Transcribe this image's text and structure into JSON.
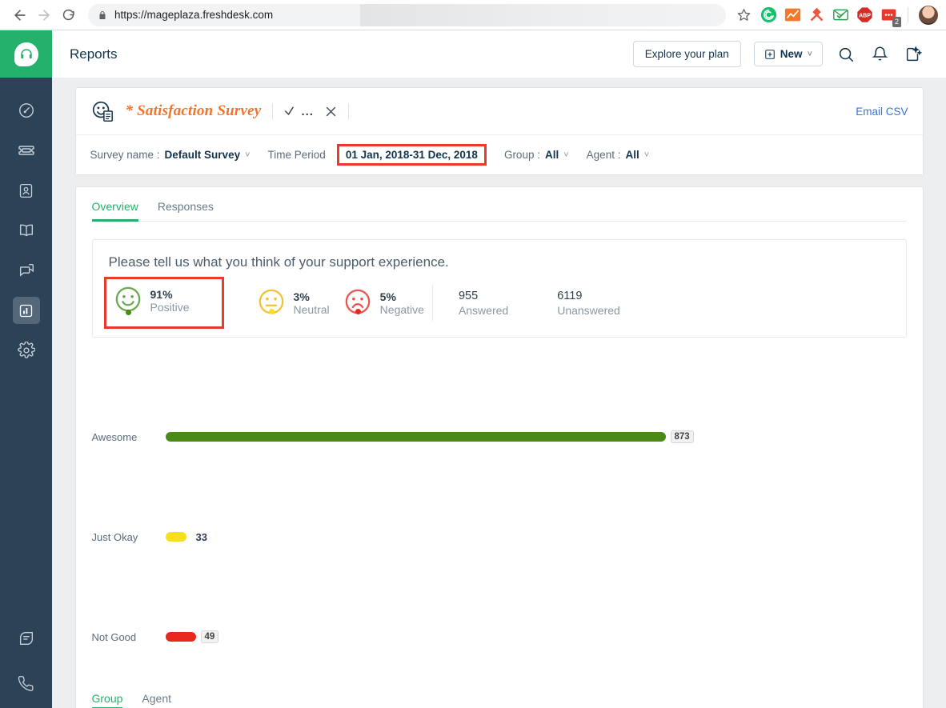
{
  "browser": {
    "url": "https://mageplaza.freshdesk.com",
    "back_icon": "back-arrow-icon",
    "forward_icon": "forward-arrow-icon",
    "reload_icon": "reload-icon",
    "lock_icon": "lock-icon",
    "bookmark_icon": "star-icon",
    "extensions": [
      {
        "name": "grammarly-extension",
        "badge": ""
      },
      {
        "name": "analytics-extension",
        "badge": ""
      },
      {
        "name": "pocket-extension",
        "badge": ""
      },
      {
        "name": "mailtrack-extension",
        "badge": ""
      },
      {
        "name": "adblock-plus-extension",
        "badge": ""
      },
      {
        "name": "notes-extension",
        "badge": "2"
      }
    ]
  },
  "sidebar": {
    "brand_icon": "freshdesk-headset-logo",
    "items": [
      {
        "name": "dashboard",
        "icon": "gauge-icon",
        "active": false
      },
      {
        "name": "tickets",
        "icon": "ticket-icon",
        "active": false
      },
      {
        "name": "contacts",
        "icon": "contact-card-icon",
        "active": false
      },
      {
        "name": "solutions",
        "icon": "book-icon",
        "active": false
      },
      {
        "name": "forums",
        "icon": "chat-bubbles-icon",
        "active": false
      },
      {
        "name": "reports",
        "icon": "bar-chart-icon",
        "active": true
      },
      {
        "name": "admin",
        "icon": "gear-icon",
        "active": false
      }
    ],
    "bottom_items": [
      {
        "name": "chat",
        "icon": "chat-leaf-icon"
      },
      {
        "name": "phone",
        "icon": "phone-icon"
      }
    ]
  },
  "header": {
    "title": "Reports",
    "explore_plan_label": "Explore your plan",
    "new_label": "New",
    "new_icon": "plus-square-icon",
    "new_caret": "˅",
    "search_icon": "search-icon",
    "notifications_icon": "bell-icon",
    "freddy_icon": "sparkle-ai-icon"
  },
  "survey": {
    "icon": "smiley-document-icon",
    "title": "* Satisfaction Survey",
    "save_icon": "check-more-icon",
    "close_icon": "close-x-icon",
    "email_csv_label": "Email CSV",
    "filters": {
      "survey_name_label": "Survey name :",
      "survey_name_value": "Default Survey",
      "time_period_label": "Time Period",
      "time_period_value": "01 Jan, 2018-31 Dec, 2018",
      "group_label": "Group :",
      "group_value": "All",
      "agent_label": "Agent :",
      "agent_value": "All",
      "caret": "˅"
    },
    "highlight_color": "#e8392c"
  },
  "tabs": [
    {
      "label": "Overview",
      "active": true
    },
    {
      "label": "Responses",
      "active": false
    }
  ],
  "question": {
    "text": "Please tell us what you think of your support experience.",
    "stats": [
      {
        "pct": "91%",
        "label": "Positive",
        "face": "happy",
        "color": "#6aa84f",
        "dot": "#4a8b16",
        "boxed": true
      },
      {
        "pct": "3%",
        "label": "Neutral",
        "face": "neutral",
        "color": "#f1c232",
        "dot": "#f6e01e",
        "boxed": false
      },
      {
        "pct": "5%",
        "label": "Negative",
        "face": "sad",
        "color": "#ef5350",
        "dot": "#e8281c",
        "boxed": false
      }
    ],
    "counts": [
      {
        "num": "955",
        "label": "Answered"
      },
      {
        "num": "6119",
        "label": "Unanswered"
      }
    ]
  },
  "chart_data": {
    "type": "bar",
    "title": "Please tell us what you think of your support experience.",
    "orientation": "horizontal",
    "categories": [
      "Awesome",
      "Just Okay",
      "Not Good"
    ],
    "values": [
      873,
      33,
      49
    ],
    "colors": [
      "#4a8b16",
      "#f6e01e",
      "#e8281c"
    ],
    "xlabel": "",
    "ylabel": "",
    "xlim": [
      0,
      873
    ],
    "grid": false,
    "legend": "none",
    "value_label_style": [
      "badge",
      "plain",
      "badge"
    ]
  },
  "bottom_tabs": [
    {
      "label": "Group",
      "active": true
    },
    {
      "label": "Agent",
      "active": false
    }
  ]
}
